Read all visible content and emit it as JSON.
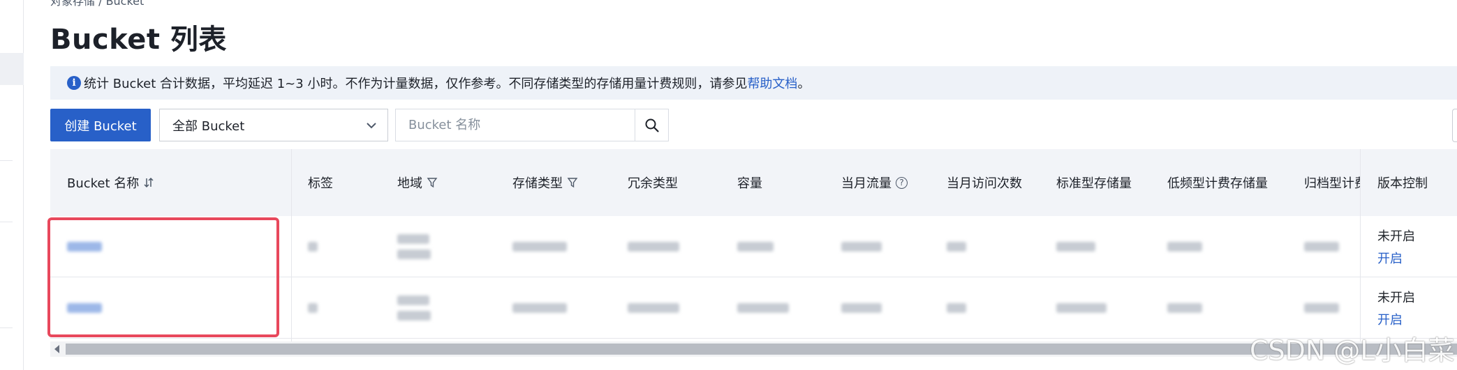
{
  "breadcrumb": "对象存储 / Bucket",
  "page_title": "Bucket 列表",
  "notice": {
    "text": "统计 Bucket 合计数据，平均延迟 1~3 小时。不作为计量数据，仅作参考。不同存储类型的存储用量计费规则，请参见",
    "link": "帮助文档",
    "end": "。"
  },
  "toolbar": {
    "create_label": "创建 Bucket",
    "filter_value": "全部 Bucket",
    "search_placeholder": "Bucket 名称"
  },
  "columns": {
    "name": "Bucket 名称",
    "tags": "标签",
    "region": "地域",
    "storage_class": "存储类型",
    "redundancy": "冗余类型",
    "capacity": "容量",
    "monthly_traffic": "当月流量",
    "monthly_requests": "当月访问次数",
    "standard_storage": "标准型存储量",
    "ia_storage": "低频型计费存储量",
    "archive_storage": "归档型计费",
    "versioning": "版本控制"
  },
  "rows": [
    {
      "versioning_status": "未开启",
      "versioning_action": "开启"
    },
    {
      "versioning_status": "未开启",
      "versioning_action": "开启"
    }
  ],
  "watermark": "CSDN @L小白菜",
  "colors": {
    "primary": "#2860c8",
    "highlight": "#e8485c",
    "header_bg": "#f2f4f8",
    "notice_bg": "#eef2f8"
  }
}
